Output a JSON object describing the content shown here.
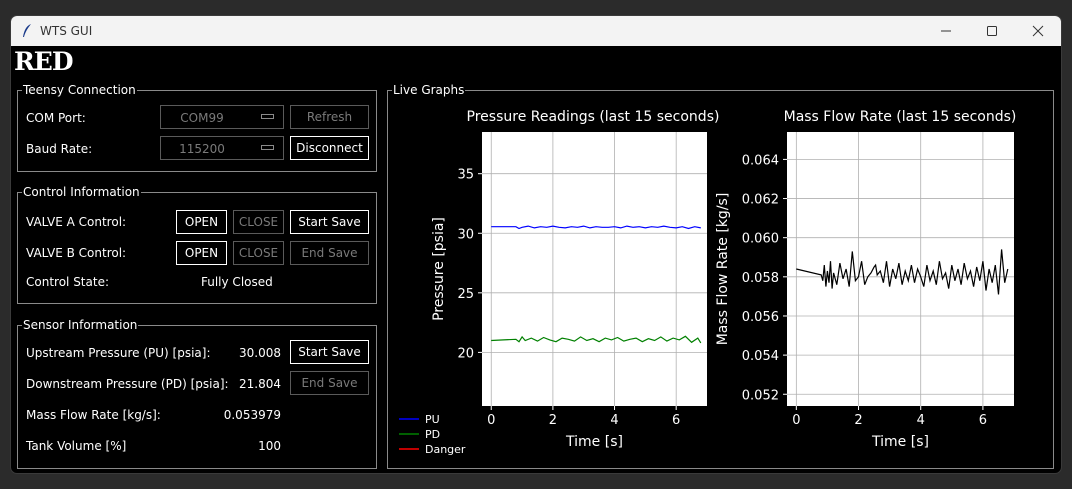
{
  "window": {
    "title": "WTS GUI"
  },
  "logo": {
    "text": "RED"
  },
  "teensy": {
    "legend": "Teensy Connection",
    "com_label": "COM Port:",
    "com_value": "COM99",
    "refresh_label": "Refresh",
    "baud_label": "Baud Rate:",
    "baud_value": "115200",
    "disconnect_label": "Disconnect"
  },
  "control": {
    "legend": "Control Information",
    "valve_a_label": "VALVE A Control:",
    "valve_b_label": "VALVE B Control:",
    "open_label": "OPEN",
    "close_label": "CLOSE",
    "start_save_label": "Start Save",
    "end_save_label": "End Save",
    "state_label": "Control State:",
    "state_value": "Fully Closed"
  },
  "sensor": {
    "legend": "Sensor Information",
    "pu_label": "Upstream Pressure (PU) [psia]:",
    "pu_value": "30.008",
    "pd_label": "Downstream Pressure (PD) [psia]:",
    "pd_value": "21.804",
    "mfr_label": "Mass Flow Rate [kg/s]:",
    "mfr_value": "0.053979",
    "tank_label": "Tank Volume [%]",
    "tank_value": "100",
    "start_save_label": "Start Save",
    "end_save_label": "End Save"
  },
  "graphs": {
    "legend": "Live Graphs"
  },
  "colors": {
    "pu": "#0000ff",
    "pd": "#008000",
    "danger": "#ff0000",
    "mass": "#000000"
  },
  "chart_data": [
    {
      "type": "line",
      "title": "Pressure Readings (last 15 seconds)",
      "xlabel": "Time [s]",
      "ylabel": "Pressure [psia]",
      "xlim": [
        -0.3,
        7.0
      ],
      "ylim": [
        15.5,
        38.5
      ],
      "xticks": [
        0,
        2,
        4,
        6
      ],
      "yticks": [
        20,
        25,
        30,
        35
      ],
      "grid": true,
      "legend_position": "below-left",
      "series": [
        {
          "name": "PU",
          "color": "#0000ff",
          "x": [
            0,
            0.4,
            0.8,
            0.9,
            1.0,
            1.2,
            1.4,
            1.6,
            1.8,
            2.0,
            2.2,
            2.4,
            2.6,
            2.8,
            3.0,
            3.2,
            3.4,
            3.6,
            3.8,
            4.0,
            4.2,
            4.4,
            4.6,
            4.8,
            5.0,
            5.2,
            5.4,
            5.6,
            5.8,
            6.0,
            6.2,
            6.4,
            6.6,
            6.8
          ],
          "y": [
            30.55,
            30.55,
            30.55,
            30.4,
            30.5,
            30.6,
            30.45,
            30.55,
            30.5,
            30.6,
            30.5,
            30.45,
            30.55,
            30.5,
            30.6,
            30.45,
            30.55,
            30.5,
            30.5,
            30.55,
            30.45,
            30.6,
            30.5,
            30.55,
            30.45,
            30.55,
            30.5,
            30.6,
            30.5,
            30.45,
            30.55,
            30.4,
            30.55,
            30.45
          ]
        },
        {
          "name": "PD",
          "color": "#008000",
          "x": [
            0,
            0.4,
            0.8,
            0.9,
            1.0,
            1.1,
            1.3,
            1.5,
            1.7,
            1.9,
            2.1,
            2.3,
            2.5,
            2.7,
            2.9,
            3.1,
            3.3,
            3.5,
            3.7,
            3.9,
            4.1,
            4.3,
            4.5,
            4.7,
            4.9,
            5.1,
            5.3,
            5.5,
            5.7,
            5.9,
            6.1,
            6.3,
            6.5,
            6.7,
            6.8
          ],
          "y": [
            21.0,
            21.05,
            21.1,
            20.9,
            21.3,
            21.0,
            21.2,
            20.95,
            21.25,
            21.05,
            20.9,
            21.2,
            21.1,
            20.95,
            21.3,
            21.0,
            21.15,
            20.9,
            21.2,
            21.05,
            21.25,
            20.95,
            21.1,
            21.2,
            20.9,
            21.15,
            21.0,
            21.3,
            20.95,
            21.2,
            21.05,
            21.35,
            20.85,
            21.2,
            20.8
          ]
        },
        {
          "name": "Danger",
          "color": "#ff0000",
          "x": [],
          "y": []
        }
      ]
    },
    {
      "type": "line",
      "title": "Mass Flow Rate (last 15 seconds)",
      "xlabel": "Time [s]",
      "ylabel": "Mass Flow Rate [kg/s]",
      "xlim": [
        -0.3,
        7.0
      ],
      "ylim": [
        0.0514,
        0.0654
      ],
      "xticks": [
        0,
        2,
        4,
        6
      ],
      "yticks": [
        0.052,
        0.054,
        0.056,
        0.058,
        0.06,
        0.062,
        0.064
      ],
      "grid": true,
      "series": [
        {
          "name": "Mass Flow",
          "color": "#000000",
          "x": [
            0,
            0.8,
            0.85,
            0.9,
            0.95,
            1.0,
            1.05,
            1.1,
            1.15,
            1.2,
            1.3,
            1.4,
            1.5,
            1.6,
            1.7,
            1.8,
            1.9,
            2.0,
            2.1,
            2.2,
            2.3,
            2.4,
            2.5,
            2.55,
            2.6,
            2.7,
            2.8,
            2.9,
            3.0,
            3.1,
            3.2,
            3.3,
            3.4,
            3.5,
            3.6,
            3.7,
            3.8,
            3.9,
            4.0,
            4.1,
            4.2,
            4.3,
            4.4,
            4.5,
            4.6,
            4.7,
            4.8,
            4.9,
            5.0,
            5.1,
            5.2,
            5.3,
            5.4,
            5.5,
            5.6,
            5.7,
            5.8,
            5.9,
            6.0,
            6.1,
            6.2,
            6.3,
            6.4,
            6.5,
            6.6,
            6.7,
            6.8
          ],
          "y": [
            0.0584,
            0.0581,
            0.0578,
            0.0586,
            0.0575,
            0.0583,
            0.0577,
            0.0588,
            0.0574,
            0.0582,
            0.0576,
            0.0587,
            0.0579,
            0.0584,
            0.0575,
            0.0593,
            0.0578,
            0.058,
            0.0588,
            0.0576,
            0.058,
            0.0582,
            0.0585,
            0.0586,
            0.0581,
            0.0583,
            0.0577,
            0.0588,
            0.0575,
            0.0584,
            0.0579,
            0.0587,
            0.0576,
            0.0583,
            0.0578,
            0.0586,
            0.0577,
            0.0584,
            0.058,
            0.0575,
            0.0586,
            0.0578,
            0.0583,
            0.0576,
            0.0588,
            0.0579,
            0.0582,
            0.0574,
            0.0586,
            0.0578,
            0.0584,
            0.0576,
            0.0587,
            0.0579,
            0.0583,
            0.0575,
            0.0585,
            0.0578,
            0.0588,
            0.0573,
            0.0584,
            0.0577,
            0.0586,
            0.0571,
            0.0594,
            0.0577,
            0.0584
          ]
        }
      ]
    }
  ]
}
